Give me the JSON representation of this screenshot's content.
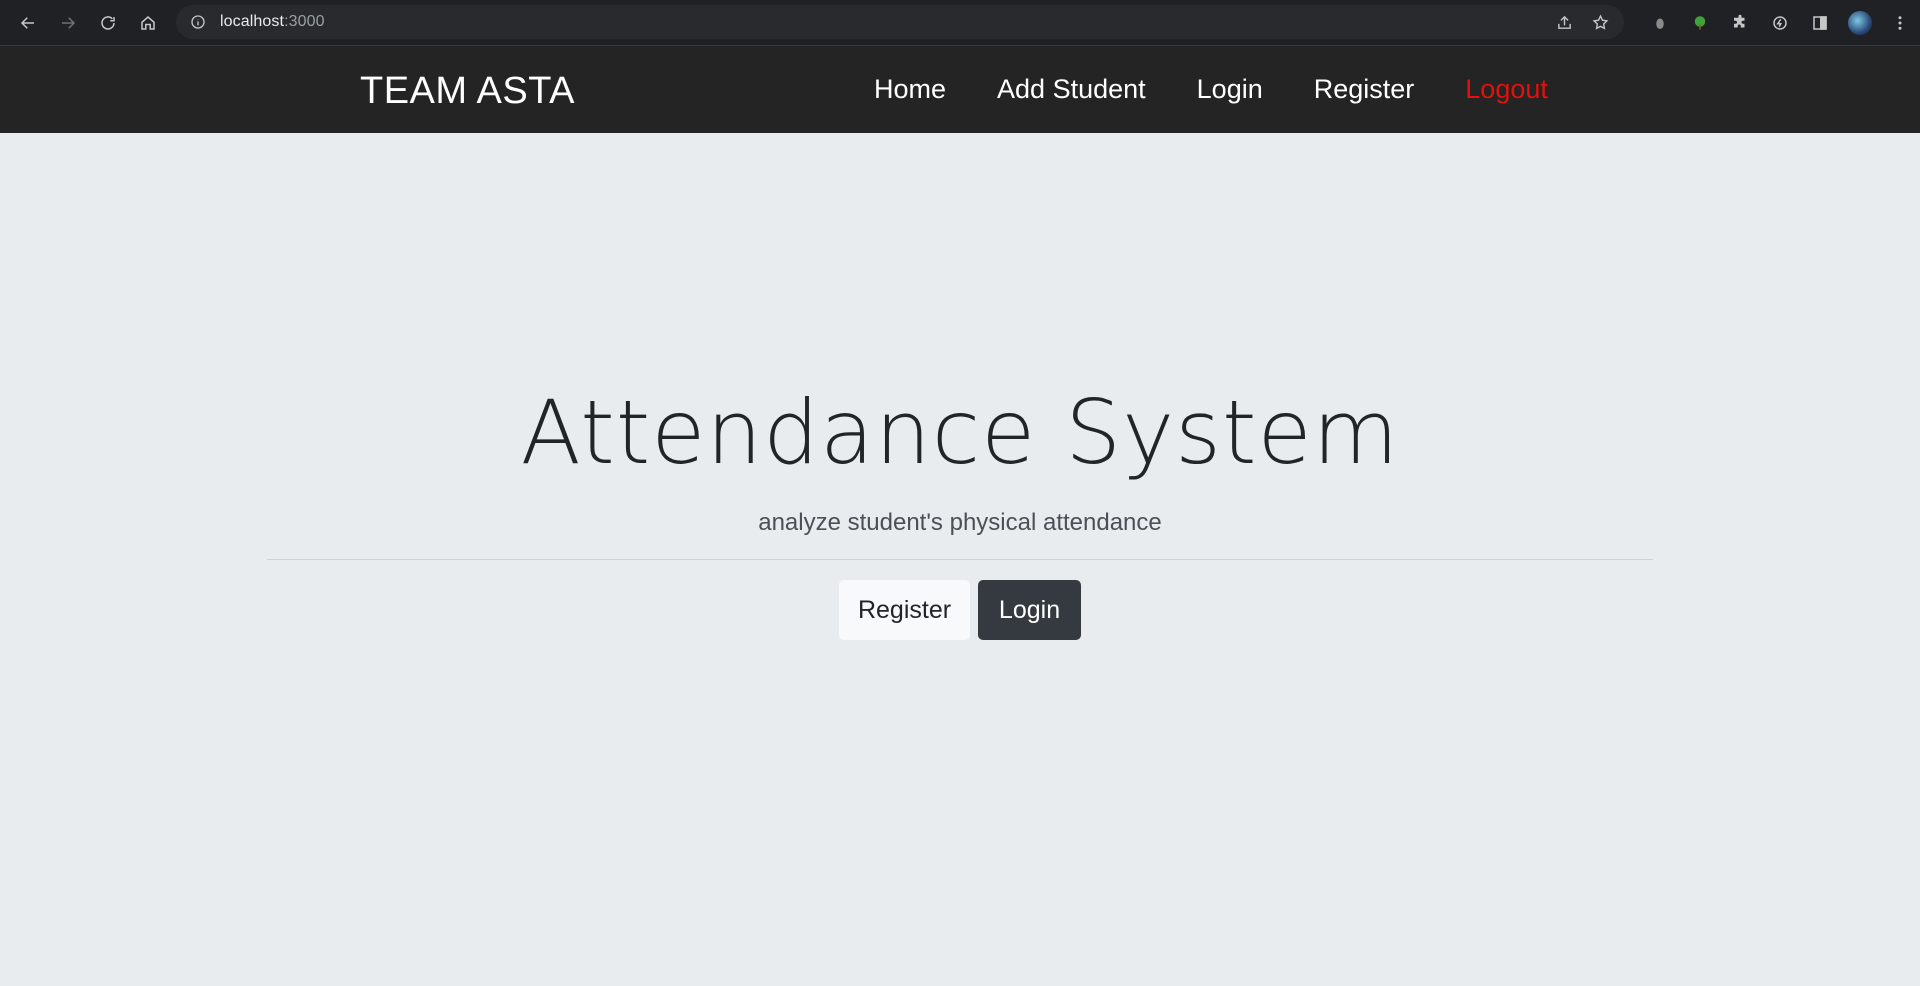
{
  "browser": {
    "url_host": "localhost",
    "url_port": ":3000"
  },
  "navbar": {
    "brand": "TEAM ASTA",
    "links": [
      {
        "label": "Home"
      },
      {
        "label": "Add Student"
      },
      {
        "label": "Login"
      },
      {
        "label": "Register"
      },
      {
        "label": "Logout"
      }
    ],
    "logout_color": "#e3100b"
  },
  "hero": {
    "title": "Attendance System",
    "lead": "analyze student's physical attendance",
    "register_label": "Register",
    "login_label": "Login"
  },
  "colors": {
    "page_bg": "#e9ecef",
    "navbar_bg": "#242424",
    "dark_button": "#343a40",
    "light_button": "#f8f9fa"
  }
}
